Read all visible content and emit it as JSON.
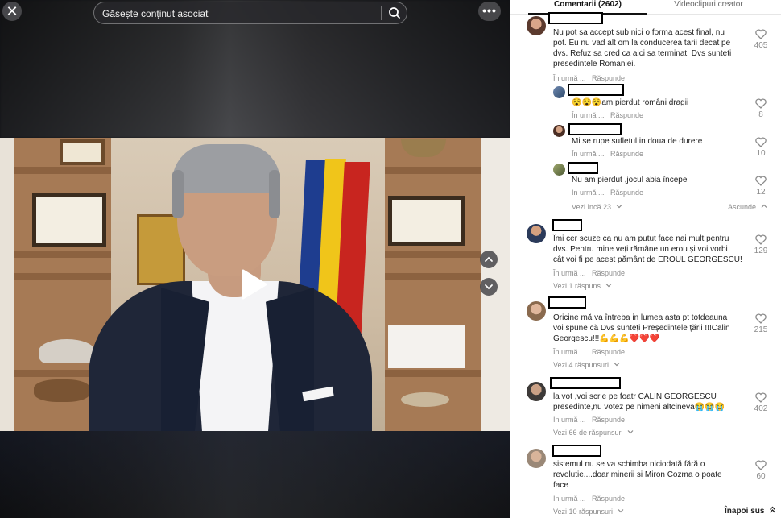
{
  "search": {
    "placeholder": "Găsește conținut asociat"
  },
  "video": {
    "close_symbol": "✕",
    "more_symbol": "•••"
  },
  "tabs": {
    "comments": "Comentarii (2602)",
    "creator": "Videoclipuri creator"
  },
  "meta": {
    "time": "În urmă ...",
    "reply": "Răspunde"
  },
  "comments": [
    {
      "text1": "Nu pot sa accept sub nici o forma acest final, nu",
      "text2": "pot. Eu nu vad alt om la conducerea tarii decat pe",
      "text3": "dvs. Refuz sa cred ca aici sa terminat. Dvs sunteti",
      "text4": "presedintele Romaniei.",
      "likes": "405"
    },
    {
      "text1": "😵😵😵am pierdut români dragii",
      "likes": "8"
    },
    {
      "text1": "Mi se rupe sufletul in doua de durere",
      "likes": "10"
    },
    {
      "text1": "Nu am pierdut ,jocul abia începe",
      "likes": "12"
    },
    {
      "text1": "Îmi cer scuze ca nu am putut face nai mult pentru",
      "text2": "dvs. Pentru mine veți rămâne un erou și voi vorbi",
      "text3": "cât voi fi pe acest pământ de EROUL GEORGESCU!",
      "likes": "129"
    },
    {
      "text1": "Oricine mă va întreba in lumea asta pt totdeauna",
      "text2": "voi spune că Dvs sunteți Președintele țării !!!Calin",
      "text3": "Georgescu!!!💪💪💪❤️❤️❤️",
      "likes": "215"
    },
    {
      "text1": "la vot ,voi scrie pe foatr CALIN GEORGESCU",
      "text2": "presedinte,nu votez pe nimeni altcineva😭😭😭",
      "likes": "402"
    },
    {
      "text1": "sistemul nu se va schimba niciodată fără o",
      "text2": "revolutie....doar minerii si Miron Cozma o poate",
      "text3": "face",
      "likes": "60"
    }
  ],
  "links": {
    "more_23": "Vezi încă 23",
    "collapse": "Ascunde",
    "replies_1": "Vezi 1 răspuns",
    "replies_4": "Vezi 4 răspunsuri",
    "replies_66": "Vezi 66 de răspunsuri",
    "replies_10": "Vezi 10 răspunsuri",
    "back_top": "Înapoi sus"
  },
  "icons": {
    "close": "close-icon",
    "search": "search-icon",
    "more": "more-icon",
    "play": "play-icon",
    "up": "chevron-up-icon",
    "down": "chevron-down-icon",
    "like": "heart-icon"
  }
}
